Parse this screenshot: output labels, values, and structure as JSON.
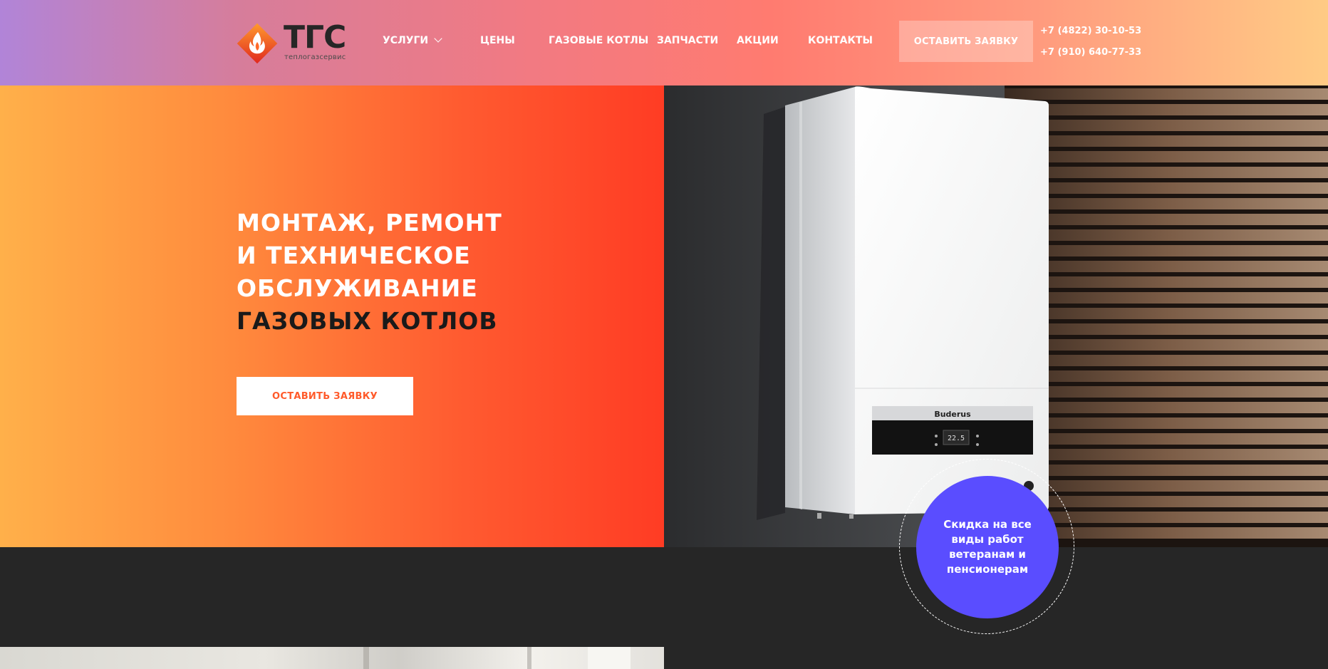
{
  "brand": {
    "logo_text": "ТГС",
    "logo_subtitle": "теплогазсервис",
    "colors": {
      "orange": "#ff5a2a",
      "red": "#e8322e",
      "dark": "#262626",
      "purple_badge": "#5a4dff"
    }
  },
  "nav": {
    "items": [
      {
        "label": "УСЛУГИ",
        "has_dropdown": true,
        "icon": "chevron-down-icon"
      },
      {
        "label": "ЦЕНЫ"
      },
      {
        "label": "ГАЗОВЫЕ КОТЛЫ"
      },
      {
        "label": "ЗАПЧАСТИ"
      },
      {
        "label": "АКЦИИ"
      },
      {
        "label": "КОНТАКТЫ"
      }
    ]
  },
  "header": {
    "cta_label": "ОСТАВИТЬ ЗАЯВКУ",
    "phones": [
      "+7 (4822) 30-10-53",
      "+7 (910) 640-77-33"
    ]
  },
  "hero": {
    "title_lines": [
      "МОНТАЖ, РЕМОНТ",
      "И ТЕХНИЧЕСКОЕ",
      "ОБСЛУЖИВАНИЕ",
      "ГАЗОВЫХ КОТЛОВ"
    ],
    "cta_label": "ОСТАВИТЬ ЗАЯВКУ",
    "boiler": {
      "brand": "Buderus",
      "display_value": "22.5"
    }
  },
  "badge": {
    "text": "Скидка на все виды работ ветеранам и пенсионерам"
  }
}
